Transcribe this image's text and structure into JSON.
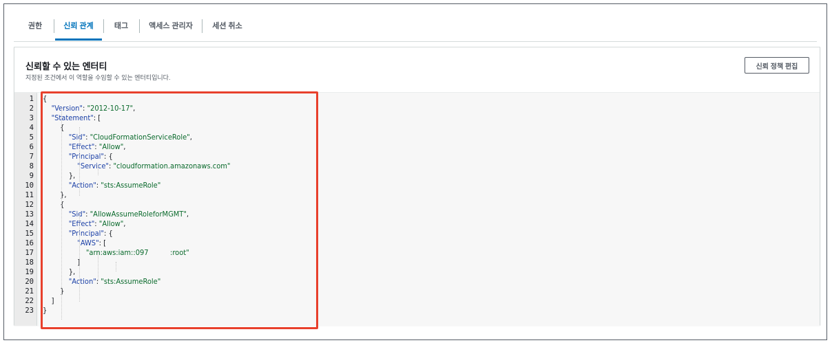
{
  "tabs": [
    {
      "label": "권한",
      "active": false
    },
    {
      "label": "신뢰 관계",
      "active": true
    },
    {
      "label": "태그",
      "active": false
    },
    {
      "label": "액세스 관리자",
      "active": false
    },
    {
      "label": "세션 취소",
      "active": false
    }
  ],
  "panel": {
    "title": "신뢰할 수 있는 엔터티",
    "description": "지정된 조건에서 이 역할을 수임할 수 있는 엔터티입니다.",
    "edit_button": "신뢰 정책 편집"
  },
  "colors": {
    "accent": "#0073bb",
    "highlight_border": "#e8402c",
    "json_key": "#1a3fa6",
    "json_string": "#0a6a2c"
  },
  "code": {
    "line_numbers": [
      "1",
      "2",
      "3",
      "4",
      "5",
      "6",
      "7",
      "8",
      "9",
      "10",
      "11",
      "12",
      "13",
      "14",
      "15",
      "16",
      "17",
      "18",
      "19",
      "20",
      "21",
      "22",
      "23"
    ],
    "lines": [
      [
        {
          "t": "p",
          "v": "{"
        }
      ],
      [
        {
          "t": "p",
          "v": "    "
        },
        {
          "t": "k",
          "v": "\"Version\""
        },
        {
          "t": "p",
          "v": ": "
        },
        {
          "t": "s",
          "v": "\"2012-10-17\""
        },
        {
          "t": "p",
          "v": ","
        }
      ],
      [
        {
          "t": "p",
          "v": "    "
        },
        {
          "t": "k",
          "v": "\"Statement\""
        },
        {
          "t": "p",
          "v": ": ["
        }
      ],
      [
        {
          "t": "p",
          "v": "        {"
        }
      ],
      [
        {
          "t": "p",
          "v": "            "
        },
        {
          "t": "k",
          "v": "\"Sid\""
        },
        {
          "t": "p",
          "v": ": "
        },
        {
          "t": "s",
          "v": "\"CloudFormationServiceRole\""
        },
        {
          "t": "p",
          "v": ","
        }
      ],
      [
        {
          "t": "p",
          "v": "            "
        },
        {
          "t": "k",
          "v": "\"Effect\""
        },
        {
          "t": "p",
          "v": ": "
        },
        {
          "t": "s",
          "v": "\"Allow\""
        },
        {
          "t": "p",
          "v": ","
        }
      ],
      [
        {
          "t": "p",
          "v": "            "
        },
        {
          "t": "k",
          "v": "\"Principal\""
        },
        {
          "t": "p",
          "v": ": {"
        }
      ],
      [
        {
          "t": "p",
          "v": "                "
        },
        {
          "t": "k",
          "v": "\"Service\""
        },
        {
          "t": "p",
          "v": ": "
        },
        {
          "t": "s",
          "v": "\"cloudformation.amazonaws.com\""
        }
      ],
      [
        {
          "t": "p",
          "v": "            },"
        }
      ],
      [
        {
          "t": "p",
          "v": "            "
        },
        {
          "t": "k",
          "v": "\"Action\""
        },
        {
          "t": "p",
          "v": ": "
        },
        {
          "t": "s",
          "v": "\"sts:AssumeRole\""
        }
      ],
      [
        {
          "t": "p",
          "v": "        },"
        }
      ],
      [
        {
          "t": "p",
          "v": "        {"
        }
      ],
      [
        {
          "t": "p",
          "v": "            "
        },
        {
          "t": "k",
          "v": "\"Sid\""
        },
        {
          "t": "p",
          "v": ": "
        },
        {
          "t": "s",
          "v": "\"AllowAssumeRoleforMGMT\""
        },
        {
          "t": "p",
          "v": ","
        }
      ],
      [
        {
          "t": "p",
          "v": "            "
        },
        {
          "t": "k",
          "v": "\"Effect\""
        },
        {
          "t": "p",
          "v": ": "
        },
        {
          "t": "s",
          "v": "\"Allow\""
        },
        {
          "t": "p",
          "v": ","
        }
      ],
      [
        {
          "t": "p",
          "v": "            "
        },
        {
          "t": "k",
          "v": "\"Principal\""
        },
        {
          "t": "p",
          "v": ": {"
        }
      ],
      [
        {
          "t": "p",
          "v": "                "
        },
        {
          "t": "k",
          "v": "\"AWS\""
        },
        {
          "t": "p",
          "v": ": ["
        }
      ],
      [
        {
          "t": "p",
          "v": "                    "
        },
        {
          "t": "s",
          "v": "\"arn:aws:iam::097          :root\""
        }
      ],
      [
        {
          "t": "p",
          "v": "                ]"
        }
      ],
      [
        {
          "t": "p",
          "v": "            },"
        }
      ],
      [
        {
          "t": "p",
          "v": "            "
        },
        {
          "t": "k",
          "v": "\"Action\""
        },
        {
          "t": "p",
          "v": ": "
        },
        {
          "t": "s",
          "v": "\"sts:AssumeRole\""
        }
      ],
      [
        {
          "t": "p",
          "v": "        }"
        }
      ],
      [
        {
          "t": "p",
          "v": "    ]"
        }
      ],
      [
        {
          "t": "p",
          "v": "}"
        }
      ]
    ]
  }
}
